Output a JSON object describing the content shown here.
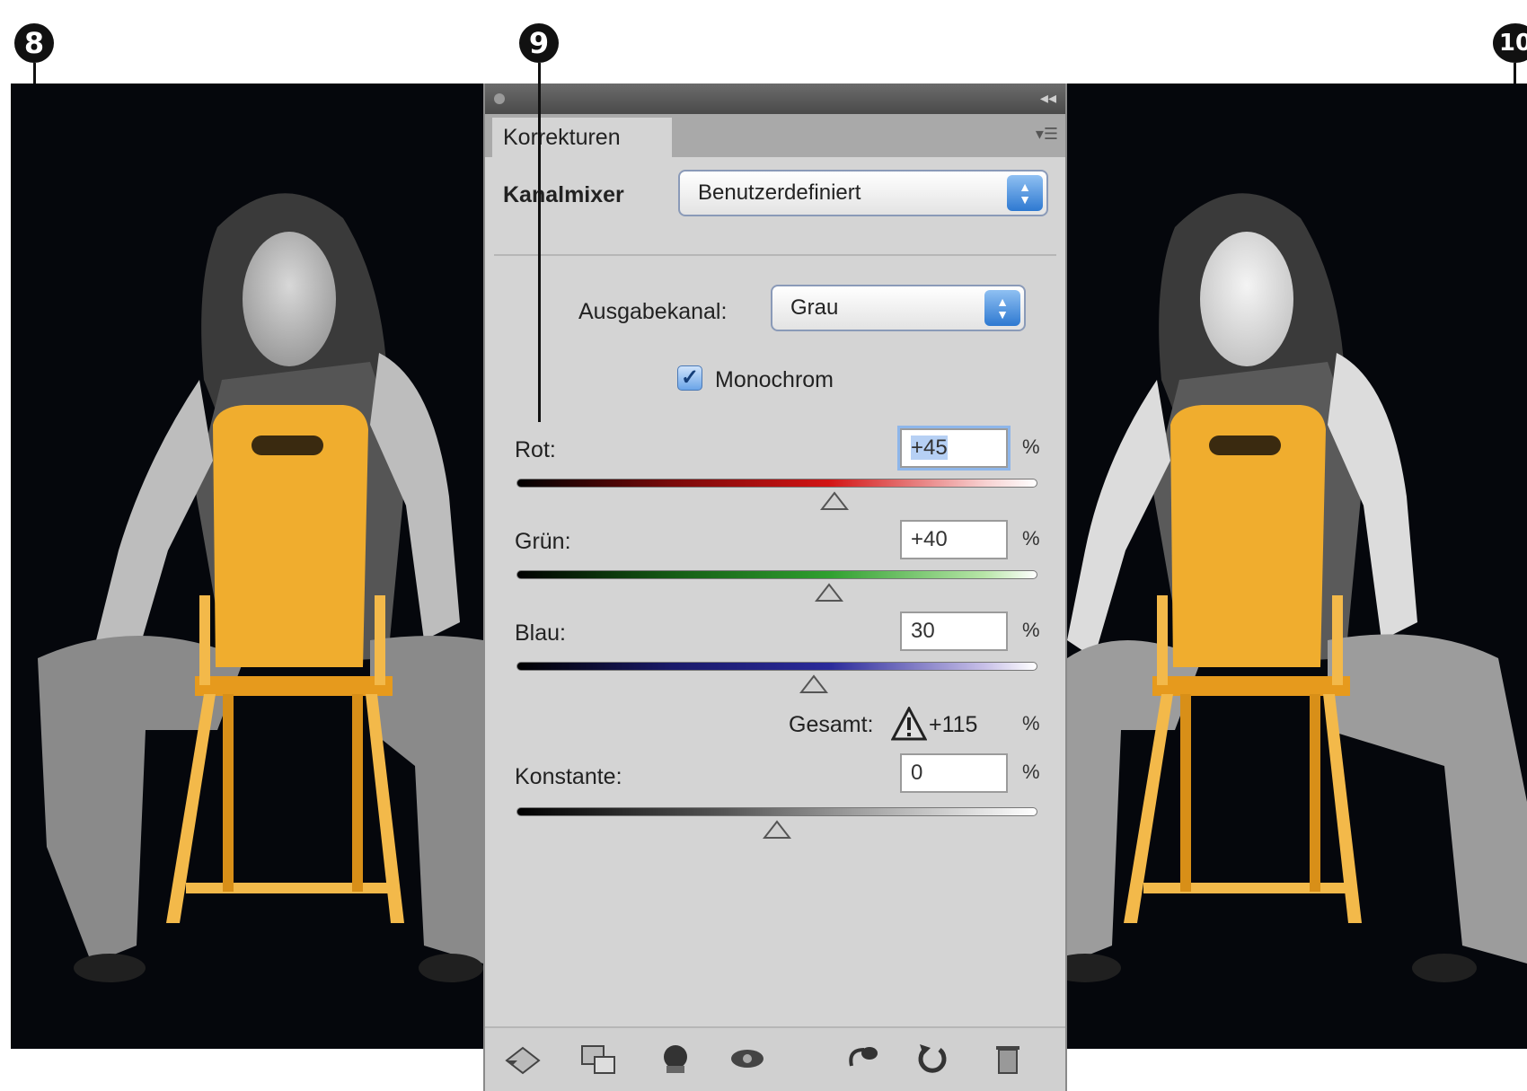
{
  "markers": {
    "left": "8",
    "center": "9",
    "right": "10"
  },
  "panel": {
    "tab_label": "Korrekturen",
    "adjustment_name": "Kanalmixer",
    "preset_value": "Benutzerdefiniert",
    "output_channel_label": "Ausgabekanal:",
    "output_channel_value": "Grau",
    "monochrome_label": "Monochrom",
    "monochrome_checked": true,
    "sliders": [
      {
        "label": "Rot:",
        "value": "+45",
        "unit": "%",
        "position": 0.61,
        "color": "#d21414"
      },
      {
        "label": "Grün:",
        "value": "+40",
        "unit": "%",
        "position": 0.6,
        "color": "#2fa02f"
      },
      {
        "label": "Blau:",
        "value": "30",
        "unit": "%",
        "position": 0.57,
        "color": "#2a2a9a"
      }
    ],
    "total_label": "Gesamt:",
    "total_value": "+115",
    "total_unit": "%",
    "constant": {
      "label": "Konstante:",
      "value": "0",
      "unit": "%",
      "position": 0.5
    },
    "footer_icons": [
      "back-icon",
      "panel-view-icon",
      "clip-to-layer-icon",
      "visibility-icon",
      "previous-state-icon",
      "reset-icon",
      "trash-icon"
    ]
  },
  "colors": {
    "chair": "#f0ad2e",
    "panel_bg": "#d4d4d4",
    "photo_bg": "#05070c"
  }
}
